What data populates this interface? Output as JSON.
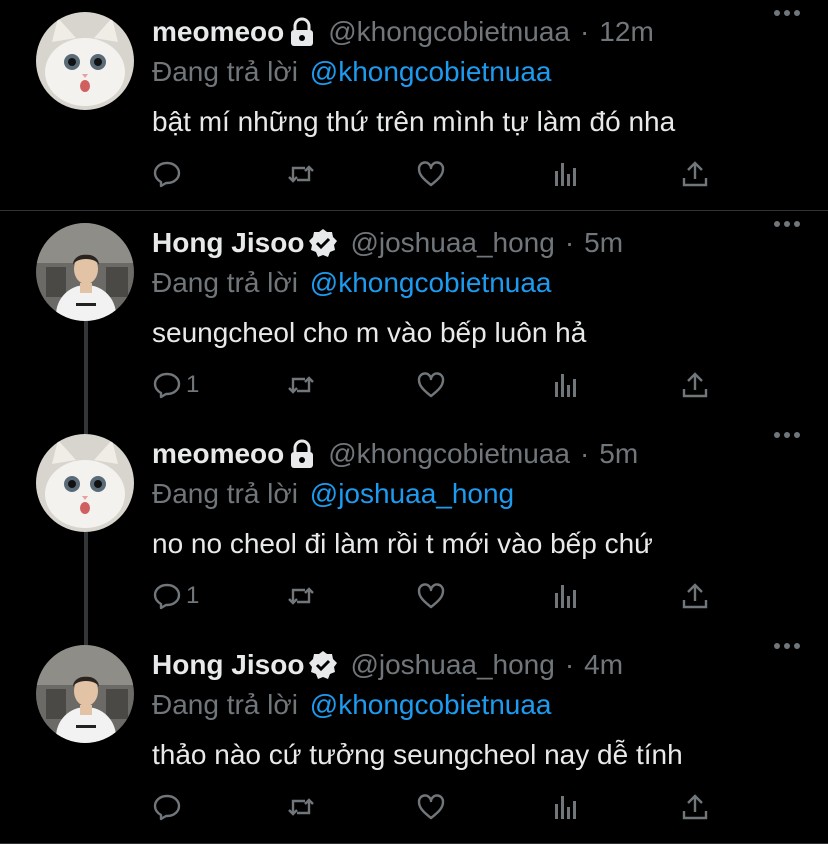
{
  "reply_prefix": "Đang trả lời",
  "tweets": [
    {
      "name": "meomeoo",
      "badge": "lock-icon",
      "handle": "@khongcobietnuaa",
      "sep": "·",
      "time": "12m",
      "reply_to": "@khongcobietnuaa",
      "text": "bật mí những thứ trên mình tự làm đó nha",
      "reply_count": ""
    },
    {
      "name": "Hong Jisoo",
      "badge": "verified-icon",
      "handle": "@joshuaa_hong",
      "sep": "·",
      "time": "5m",
      "reply_to": "@khongcobietnuaa",
      "text": "seungcheol cho m vào bếp luôn hả",
      "reply_count": "1"
    },
    {
      "name": "meomeoo",
      "badge": "lock-icon",
      "handle": "@khongcobietnuaa",
      "sep": "·",
      "time": "5m",
      "reply_to": "@joshuaa_hong",
      "text": "no no cheol đi làm rồi t mới vào bếp chứ",
      "reply_count": "1"
    },
    {
      "name": "Hong Jisoo",
      "badge": "verified-icon",
      "handle": "@joshuaa_hong",
      "sep": "·",
      "time": "4m",
      "reply_to": "@khongcobietnuaa",
      "text": "thảo nào cứ tưởng seungcheol nay dễ tính",
      "reply_count": ""
    }
  ],
  "colors": {
    "background": "#000000",
    "text": "#e7e9ea",
    "muted": "#71767b",
    "link": "#1d9bf0",
    "divider": "#2f3336"
  }
}
